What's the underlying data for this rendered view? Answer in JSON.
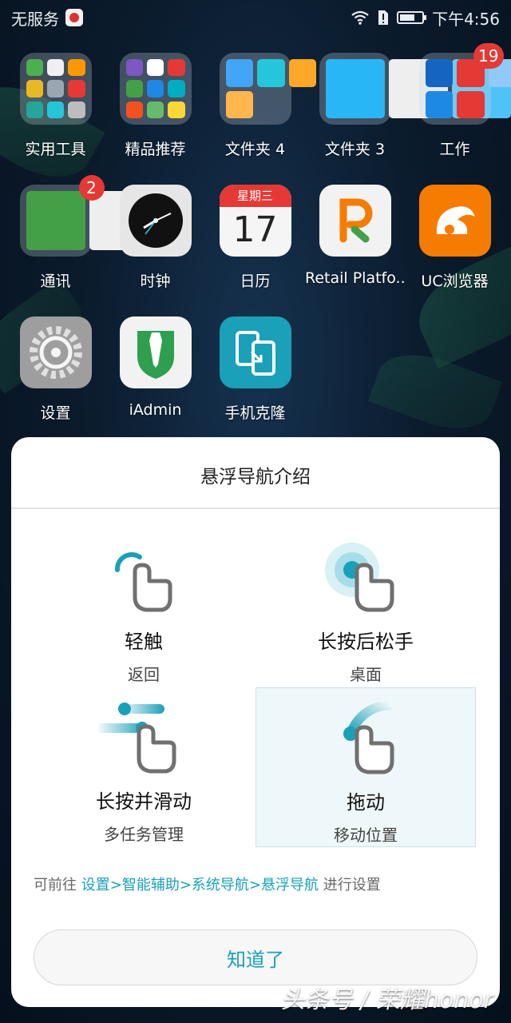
{
  "status_bar": {
    "carrier": "无服务",
    "time": "下午4:56",
    "battery_level": 0.7
  },
  "home_screen": {
    "apps": [
      {
        "label": "实用工具",
        "icon": "folder-icon",
        "badge": ""
      },
      {
        "label": "精品推荐",
        "icon": "folder-icon",
        "badge": ""
      },
      {
        "label": "文件夹 4",
        "icon": "folder-icon",
        "badge": ""
      },
      {
        "label": "文件夹 3",
        "icon": "folder-icon",
        "badge": ""
      },
      {
        "label": "工作",
        "icon": "folder-icon",
        "badge": "19"
      },
      {
        "label": "通讯",
        "icon": "folder-icon",
        "badge": "2"
      },
      {
        "label": "时钟",
        "icon": "clock-icon",
        "badge": ""
      },
      {
        "label": "日历",
        "icon": "calendar-icon",
        "badge": "",
        "weekday": "星期三",
        "day": "17"
      },
      {
        "label": "Retail Platfo..",
        "icon": "retail-icon",
        "badge": ""
      },
      {
        "label": "UC浏览器",
        "icon": "uc-browser-icon",
        "badge": ""
      },
      {
        "label": "设置",
        "icon": "gear-icon",
        "badge": ""
      },
      {
        "label": "iAdmin",
        "icon": "shield-tie-icon",
        "badge": ""
      },
      {
        "label": "手机克隆",
        "icon": "phone-clone-icon",
        "badge": ""
      }
    ]
  },
  "dialog": {
    "title": "悬浮导航介绍",
    "gestures": [
      {
        "title": "轻触",
        "subtitle": "返回",
        "icon": "tap-icon"
      },
      {
        "title": "长按后松手",
        "subtitle": "桌面",
        "icon": "long-press-icon"
      },
      {
        "title": "长按并滑动",
        "subtitle": "多任务管理",
        "icon": "long-press-slide-icon"
      },
      {
        "title": "拖动",
        "subtitle": "移动位置",
        "icon": "drag-icon",
        "selected": true
      }
    ],
    "hint_prefix": "可前往",
    "hint_link": "设置>智能辅助>系统导航>悬浮导航",
    "hint_suffix": "进行设置",
    "confirm_label": "知道了"
  },
  "watermark": "头条号 / 荣耀honor",
  "colors": {
    "accent": "#1aa0b8",
    "badge": "#e53935"
  }
}
